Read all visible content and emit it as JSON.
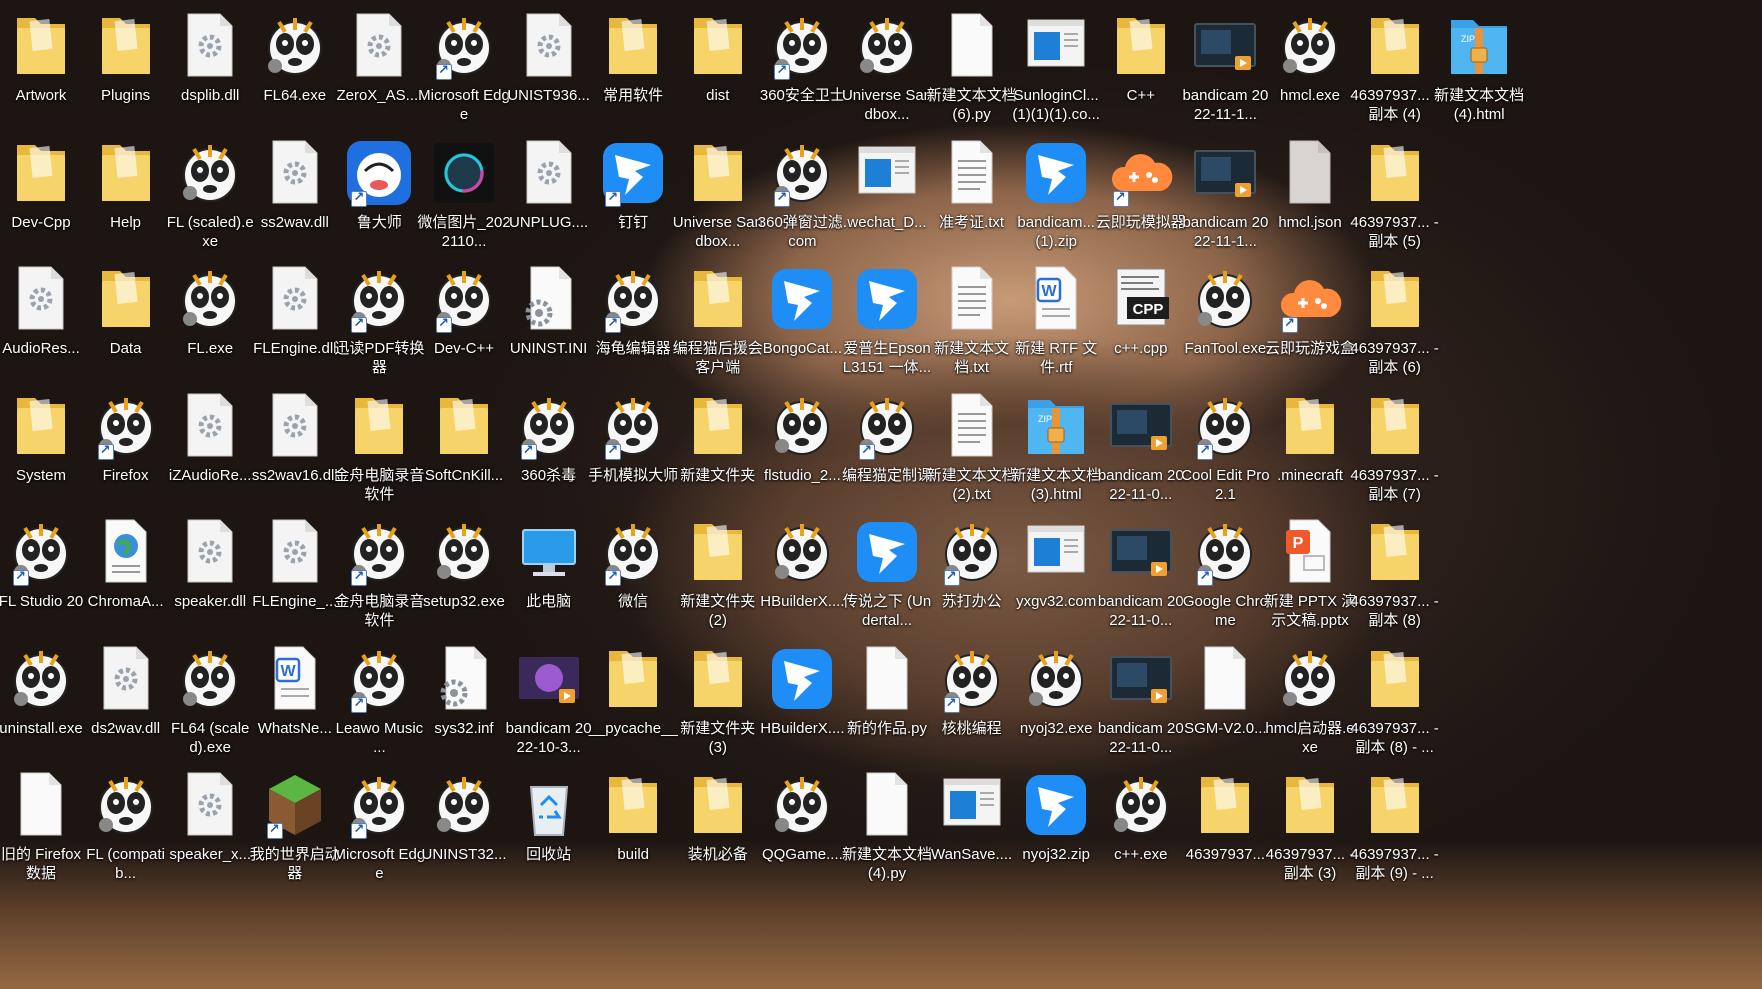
{
  "desktop": {
    "rows": 7,
    "columns": 18,
    "icons": [
      {
        "label": "Artwork",
        "type": "folder",
        "shortcut": false
      },
      {
        "label": "Dev-Cpp",
        "type": "folder",
        "shortcut": false
      },
      {
        "label": "AudioRes...",
        "type": "dll",
        "shortcut": false
      },
      {
        "label": "System",
        "type": "folder",
        "shortcut": false
      },
      {
        "label": "FL Studio 20",
        "type": "fl",
        "shortcut": true
      },
      {
        "label": "uninstall.exe",
        "type": "fl",
        "shortcut": false
      },
      {
        "label": "旧的 Firefox 数据",
        "type": "file",
        "shortcut": false
      },
      {
        "label": "Plugins",
        "type": "folder",
        "shortcut": false
      },
      {
        "label": "Help",
        "type": "folder",
        "shortcut": false
      },
      {
        "label": "Data",
        "type": "folder",
        "shortcut": false
      },
      {
        "label": "Firefox",
        "type": "fl",
        "shortcut": true
      },
      {
        "label": "ChromaA...",
        "type": "web",
        "shortcut": false
      },
      {
        "label": "ds2wav.dll",
        "type": "dll",
        "shortcut": false
      },
      {
        "label": "FL (compatib...",
        "type": "fl",
        "shortcut": false
      },
      {
        "label": "dsplib.dll",
        "type": "dll",
        "shortcut": false
      },
      {
        "label": "FL (scaled).exe",
        "type": "fl",
        "shortcut": false
      },
      {
        "label": "FL.exe",
        "type": "fl",
        "shortcut": false
      },
      {
        "label": "iZAudioRe...",
        "type": "dll",
        "shortcut": false
      },
      {
        "label": "speaker.dll",
        "type": "dll",
        "shortcut": false
      },
      {
        "label": "FL64 (scaled).exe",
        "type": "fl",
        "shortcut": false
      },
      {
        "label": "speaker_x...",
        "type": "dll",
        "shortcut": false
      },
      {
        "label": "FL64.exe",
        "type": "fl",
        "shortcut": false
      },
      {
        "label": "ss2wav.dll",
        "type": "dll",
        "shortcut": false
      },
      {
        "label": "FLEngine.dll",
        "type": "dll",
        "shortcut": false
      },
      {
        "label": "ss2wav16.dll",
        "type": "dll",
        "shortcut": false
      },
      {
        "label": "FLEngine_...",
        "type": "dll",
        "shortcut": false
      },
      {
        "label": "WhatsNe...",
        "type": "word",
        "shortcut": false
      },
      {
        "label": "我的世界启动器",
        "type": "minecraft",
        "shortcut": true
      },
      {
        "label": "ZeroX_AS....",
        "type": "dll",
        "shortcut": false
      },
      {
        "label": "鲁大师",
        "type": "ludashi",
        "shortcut": true
      },
      {
        "label": "迅读PDF转换器",
        "type": "fl",
        "shortcut": true
      },
      {
        "label": "金舟电脑录音软件",
        "type": "folder",
        "shortcut": false
      },
      {
        "label": "金舟电脑录音软件",
        "type": "fl",
        "shortcut": true
      },
      {
        "label": "Leawo Music ...",
        "type": "fl",
        "shortcut": true
      },
      {
        "label": "Microsoft Edge",
        "type": "fl",
        "shortcut": true
      },
      {
        "label": "Microsoft Edge",
        "type": "fl",
        "shortcut": true
      },
      {
        "label": "微信图片_2022110...",
        "type": "image",
        "shortcut": false
      },
      {
        "label": "Dev-C++",
        "type": "fl",
        "shortcut": true
      },
      {
        "label": "SoftCnKill...",
        "type": "folder",
        "shortcut": false
      },
      {
        "label": "setup32.exe",
        "type": "fl",
        "shortcut": false
      },
      {
        "label": "sys32.inf",
        "type": "inf",
        "shortcut": false
      },
      {
        "label": "UNINST32...",
        "type": "fl",
        "shortcut": false
      },
      {
        "label": "UNIST936...",
        "type": "dll",
        "shortcut": false
      },
      {
        "label": "UNPLUG....",
        "type": "dll",
        "shortcut": false
      },
      {
        "label": "UNINST.INI",
        "type": "inf",
        "shortcut": false
      },
      {
        "label": "360杀毒",
        "type": "fl",
        "shortcut": true
      },
      {
        "label": "此电脑",
        "type": "pc",
        "shortcut": false
      },
      {
        "label": "bandicam 2022-10-3...",
        "type": "video2",
        "shortcut": false
      },
      {
        "label": "回收站",
        "type": "recycle",
        "shortcut": false
      },
      {
        "label": "常用软件",
        "type": "folder",
        "shortcut": false
      },
      {
        "label": "钉钉",
        "type": "ding",
        "shortcut": true
      },
      {
        "label": "海龟编辑器",
        "type": "fl",
        "shortcut": true
      },
      {
        "label": "手机模拟大师",
        "type": "fl",
        "shortcut": true
      },
      {
        "label": "微信",
        "type": "fl",
        "shortcut": true
      },
      {
        "label": "__pycache__",
        "type": "folder",
        "shortcut": false
      },
      {
        "label": "build",
        "type": "folder",
        "shortcut": false
      },
      {
        "label": "dist",
        "type": "folder",
        "shortcut": false
      },
      {
        "label": "Universe Sandbox...",
        "type": "folder",
        "shortcut": false
      },
      {
        "label": "编程猫后援会客户端",
        "type": "folder",
        "shortcut": false
      },
      {
        "label": "新建文件夹",
        "type": "folder",
        "shortcut": false
      },
      {
        "label": "新建文件夹 (2)",
        "type": "folder",
        "shortcut": false
      },
      {
        "label": "新建文件夹 (3)",
        "type": "folder",
        "shortcut": false
      },
      {
        "label": "装机必备",
        "type": "folder",
        "shortcut": false
      },
      {
        "label": "360安全卫士",
        "type": "fl",
        "shortcut": true
      },
      {
        "label": "360弹窗过滤.com",
        "type": "fl",
        "shortcut": true
      },
      {
        "label": "BongoCat...",
        "type": "ding",
        "shortcut": false
      },
      {
        "label": "flstudio_2...",
        "type": "fl",
        "shortcut": false
      },
      {
        "label": "HBuilderX....",
        "type": "fl",
        "shortcut": false
      },
      {
        "label": "HBuilderX....",
        "type": "ding",
        "shortcut": false
      },
      {
        "label": "QQGame....",
        "type": "fl",
        "shortcut": false
      },
      {
        "label": "Universe Sandbox...",
        "type": "fl",
        "shortcut": false
      },
      {
        "label": "wechat_D...",
        "type": "com",
        "shortcut": false
      },
      {
        "label": "爱普生Epson L3151 一体...",
        "type": "ding",
        "shortcut": false
      },
      {
        "label": "编程猫定制课",
        "type": "fl",
        "shortcut": true
      },
      {
        "label": "传说之下 (Undertal...",
        "type": "ding",
        "shortcut": false
      },
      {
        "label": "新的作品.py",
        "type": "file",
        "shortcut": false
      },
      {
        "label": "新建文本文档 (4).py",
        "type": "file",
        "shortcut": false
      },
      {
        "label": "新建文本文档 (6).py",
        "type": "file",
        "shortcut": false
      },
      {
        "label": "准考证.txt",
        "type": "txt",
        "shortcut": false
      },
      {
        "label": "新建文本文档.txt",
        "type": "txt",
        "shortcut": false
      },
      {
        "label": "新建文本文档 (2).txt",
        "type": "txt",
        "shortcut": false
      },
      {
        "label": "苏打办公",
        "type": "fl",
        "shortcut": true
      },
      {
        "label": "核桃编程",
        "type": "fl",
        "shortcut": true
      },
      {
        "label": "WanSave....",
        "type": "com",
        "shortcut": false
      },
      {
        "label": "SunloginCl... (1)(1)(1).co...",
        "type": "com",
        "shortcut": false
      },
      {
        "label": "bandicam... (1).zip",
        "type": "ding",
        "shortcut": false
      },
      {
        "label": "新建 RTF 文件.rtf",
        "type": "word",
        "shortcut": false
      },
      {
        "label": "新建文本文档 (3).html",
        "type": "zip",
        "shortcut": false
      },
      {
        "label": "yxgv32.com",
        "type": "com",
        "shortcut": false
      },
      {
        "label": "nyoj32.exe",
        "type": "fl",
        "shortcut": false
      },
      {
        "label": "nyoj32.zip",
        "type": "ding",
        "shortcut": false
      },
      {
        "label": "C++",
        "type": "folder",
        "shortcut": false
      },
      {
        "label": "云即玩模拟器",
        "type": "cloud",
        "shortcut": true
      },
      {
        "label": "c++.cpp",
        "type": "cpp",
        "shortcut": false
      },
      {
        "label": "bandicam 2022-11-0...",
        "type": "video",
        "shortcut": false
      },
      {
        "label": "bandicam 2022-11-0...",
        "type": "video",
        "shortcut": false
      },
      {
        "label": "bandicam 2022-11-0...",
        "type": "video",
        "shortcut": false
      },
      {
        "label": "c++.exe",
        "type": "fl",
        "shortcut": false
      },
      {
        "label": "bandicam 2022-11-1...",
        "type": "video",
        "shortcut": false
      },
      {
        "label": "bandicam 2022-11-1...",
        "type": "video",
        "shortcut": false
      },
      {
        "label": "FanTool.exe",
        "type": "fl",
        "shortcut": false
      },
      {
        "label": "Cool Edit Pro 2.1",
        "type": "fl",
        "shortcut": true
      },
      {
        "label": "Google Chrome",
        "type": "fl",
        "shortcut": true
      },
      {
        "label": "SGM-V2.0...",
        "type": "file",
        "shortcut": false
      },
      {
        "label": "46397937...",
        "type": "folder",
        "shortcut": false
      },
      {
        "label": "hmcl.exe",
        "type": "fl",
        "shortcut": false
      },
      {
        "label": "hmcl.json",
        "type": "blank",
        "shortcut": false
      },
      {
        "label": "云即玩游戏盒",
        "type": "cloud",
        "shortcut": true
      },
      {
        "label": ".minecraft",
        "type": "folder",
        "shortcut": false
      },
      {
        "label": "新建 PPTX 演示文稿.pptx",
        "type": "ppt",
        "shortcut": false
      },
      {
        "label": "hmcl启动器.exe",
        "type": "fl",
        "shortcut": false
      },
      {
        "label": "46397937... - 副本 (3)",
        "type": "folder",
        "shortcut": false
      },
      {
        "label": "46397937... - 副本 (4)",
        "type": "folder",
        "shortcut": false
      },
      {
        "label": "46397937... - 副本 (5)",
        "type": "folder",
        "shortcut": false
      },
      {
        "label": "46397937... - 副本 (6)",
        "type": "folder",
        "shortcut": false
      },
      {
        "label": "46397937... - 副本 (7)",
        "type": "folder",
        "shortcut": false
      },
      {
        "label": "46397937... - 副本 (8)",
        "type": "folder",
        "shortcut": false
      },
      {
        "label": "46397937... - 副本 (8) - ...",
        "type": "folder",
        "shortcut": false
      },
      {
        "label": "46397937... - 副本 (9) - ...",
        "type": "folder",
        "shortcut": false
      },
      {
        "label": "新建文本文档 (4).html",
        "type": "zip",
        "shortcut": false
      }
    ]
  },
  "colors": {
    "folder": "#f7d46a",
    "folder_dark": "#e8b83c",
    "ding": "#1e8df5",
    "label_text": "#ffffff"
  }
}
